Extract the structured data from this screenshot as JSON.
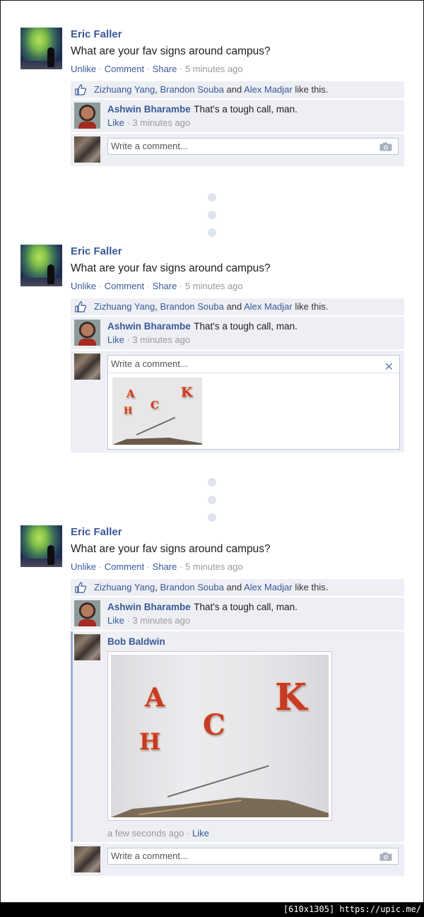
{
  "footer": {
    "text": "[610x1305] https://upic.me/"
  },
  "posts": [
    {
      "author": "Eric Faller",
      "status": "What are your fav signs around campus?",
      "actions": {
        "unlike": "Unlike",
        "comment": "Comment",
        "share": "Share",
        "time": "5 minutes ago"
      },
      "likes": {
        "name1": "Zizhuang Yang",
        "name2": "Brandon Souba",
        "and": "and",
        "name3": "Alex Madjar",
        "suffix": "like this."
      },
      "comment": {
        "author": "Ashwin Bharambe",
        "text": "That's a tough call, man.",
        "like": "Like",
        "time": "3 minutes ago"
      },
      "write_placeholder": "Write a comment..."
    },
    {
      "author": "Eric Faller",
      "status": "What are your fav signs around campus?",
      "actions": {
        "unlike": "Unlike",
        "comment": "Comment",
        "share": "Share",
        "time": "5 minutes ago"
      },
      "likes": {
        "name1": "Zizhuang Yang",
        "name2": "Brandon Souba",
        "and": "and",
        "name3": "Alex Madjar",
        "suffix": "like this."
      },
      "comment": {
        "author": "Ashwin Bharambe",
        "text": "That's a tough call, man.",
        "like": "Like",
        "time": "3 minutes ago"
      },
      "write_placeholder": "Write a comment...",
      "close_glyph": "✕"
    },
    {
      "author": "Eric Faller",
      "status": "What are your fav signs around campus?",
      "actions": {
        "unlike": "Unlike",
        "comment": "Comment",
        "share": "Share",
        "time": "5 minutes ago"
      },
      "likes": {
        "name1": "Zizhuang Yang",
        "name2": "Brandon Souba",
        "and": "and",
        "name3": "Alex Madjar",
        "suffix": "like this."
      },
      "comment": {
        "author": "Ashwin Bharambe",
        "text": "That's a tough call, man.",
        "like": "Like",
        "time": "3 minutes ago"
      },
      "photo_comment": {
        "author": "Bob Baldwin",
        "time": "a few seconds ago",
        "like": "Like"
      },
      "write_placeholder": "Write a comment..."
    }
  ],
  "hack_letters": [
    "A",
    "K",
    "H",
    "C"
  ],
  "separator": "·",
  "colors": {
    "link": "#3b5998",
    "feedback_bg": "#edeff4",
    "dot": "#dfe3ee",
    "border": "#bdc7d8"
  }
}
